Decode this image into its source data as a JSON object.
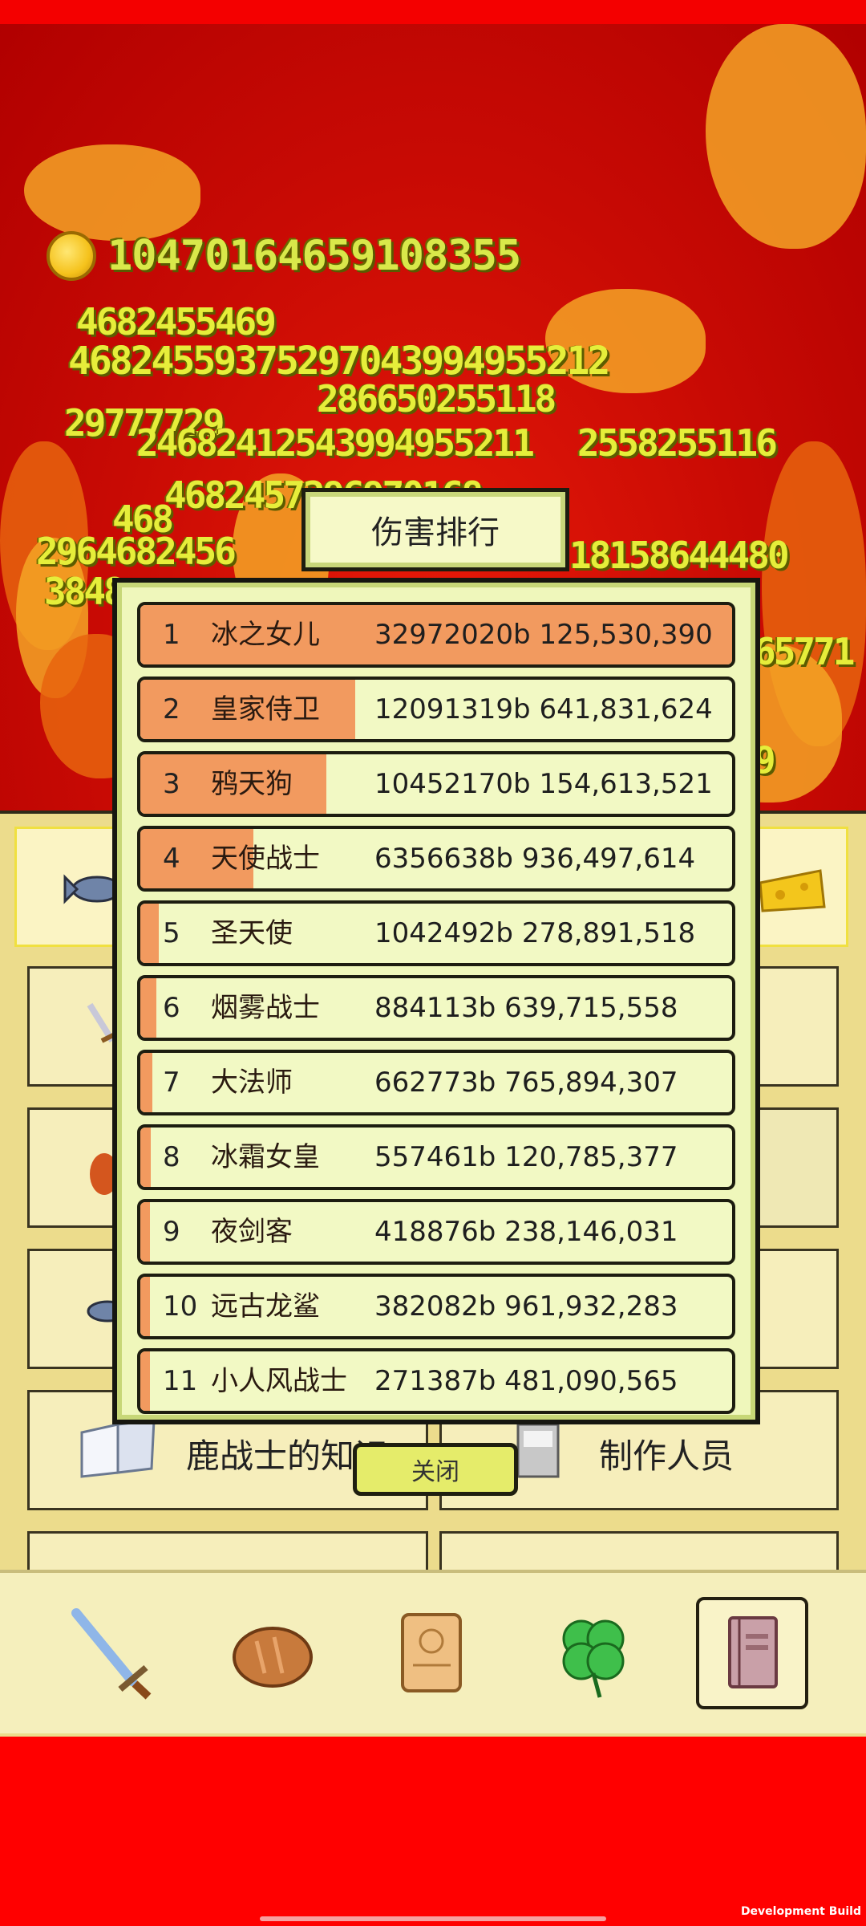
{
  "coins": {
    "total": "10470164659108355",
    "icon": "gold-coin-icon"
  },
  "damage_numbers": [
    "4682455469",
    "46824559375297043994955212",
    "286650255118",
    "29777729",
    "24682412543994955211",
    "2558255116",
    "4682457296970168",
    "2964682456",
    "18158644480",
    "3848",
    "65771",
    "468",
    "9"
  ],
  "ranking": {
    "title": "伤害排行",
    "close_label": "关闭",
    "colors": {
      "fill": "#f29a5f",
      "row": "#f2f9c4"
    },
    "rows": [
      {
        "rank": "1",
        "name": "冰之女儿",
        "score": "32972020b 125,530,390",
        "share": 1.0
      },
      {
        "rank": "2",
        "name": "皇家侍卫",
        "score": "12091319b 641,831,624",
        "share": 0.363
      },
      {
        "rank": "3",
        "name": "鸦天狗",
        "score": "10452170b 154,613,521",
        "share": 0.314
      },
      {
        "rank": "4",
        "name": "天使战士",
        "score": "6356638b 936,497,614",
        "share": 0.191
      },
      {
        "rank": "5",
        "name": "圣天使",
        "score": "1042492b 278,891,518",
        "share": 0.031
      },
      {
        "rank": "6",
        "name": "烟雾战士",
        "score": "884113b 639,715,558",
        "share": 0.027
      },
      {
        "rank": "7",
        "name": "大法师",
        "score": "662773b 765,894,307",
        "share": 0.02
      },
      {
        "rank": "8",
        "name": "冰霜女皇",
        "score": "557461b 120,785,377",
        "share": 0.017
      },
      {
        "rank": "9",
        "name": "夜剑客",
        "score": "418876b 238,146,031",
        "share": 0.013
      },
      {
        "rank": "10",
        "name": "远古龙鲨",
        "score": "382082b 961,932,283",
        "share": 0.012
      },
      {
        "rank": "11",
        "name": "小人风战士",
        "score": "271387b 481,090,565",
        "share": 0.008
      }
    ]
  },
  "menu": {
    "knowledge_label": "鹿战士的知识",
    "credits_label": "制作人员"
  },
  "bottom_nav": [
    {
      "name": "sword-icon",
      "selected": false
    },
    {
      "name": "bread-icon",
      "selected": false
    },
    {
      "name": "scroll-icon",
      "selected": false
    },
    {
      "name": "clover-icon",
      "selected": false
    },
    {
      "name": "book-icon",
      "selected": true
    }
  ],
  "footer": {
    "build_label": "Development Build"
  }
}
